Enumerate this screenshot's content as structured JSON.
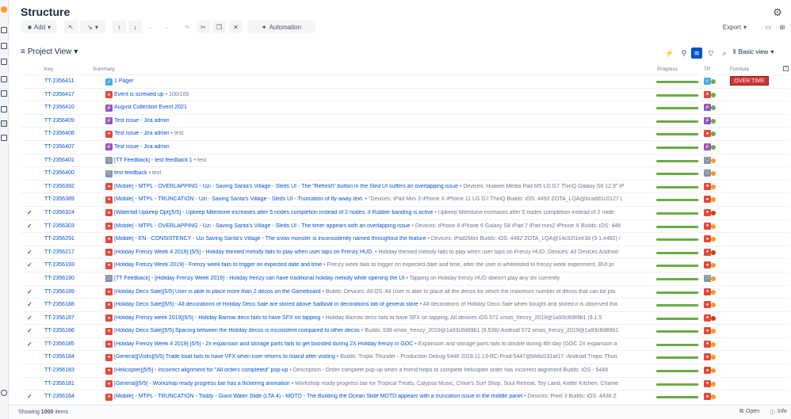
{
  "header": {
    "title": "Structure"
  },
  "toolbar": {
    "add": "Add",
    "automation": "Automation",
    "export": "Export"
  },
  "view": {
    "name": "Project View",
    "basic": "Basic view"
  },
  "columns": {
    "key": "Key",
    "summary": "Summary",
    "progress": "Progress",
    "tp": "TP",
    "formula": "Formula"
  },
  "footer": {
    "showing_prefix": "Showing ",
    "count": "1000",
    "showing_suffix": " items",
    "open": "Open",
    "info": "Info"
  },
  "colors": {
    "bug": "#e5493a",
    "story": "#4bade8",
    "task_done": "#4bade8",
    "epic": "#904ee2",
    "feedback": "#8993a4",
    "progress": "#6aab45",
    "overtime": "#c9373a"
  },
  "rows": [
    {
      "key": "TT-2356411",
      "type": "task",
      "title": "1 Pager",
      "desc": "",
      "checked": false,
      "progress": 0.98,
      "tp_status": "green",
      "formula": "OVER TIME"
    },
    {
      "key": "TT-2356417",
      "type": "bug",
      "title": "Event is screwed up",
      "desc": " • 100/100",
      "checked": false,
      "progress": 0.98,
      "tp_status": "green",
      "formula": ""
    },
    {
      "key": "TT-2356410",
      "type": "epic",
      "title": "August Collection Event 2021",
      "desc": "",
      "checked": false,
      "progress": 0.98,
      "tp_status": "green",
      "formula": ""
    },
    {
      "key": "TT-2356409",
      "type": "epic",
      "title": "Test issue - Jira admin",
      "desc": "",
      "checked": false,
      "progress": 0.98,
      "tp_status": "green",
      "formula": ""
    },
    {
      "key": "TT-2356408",
      "type": "bug",
      "title": "Test issue - Jira admin",
      "desc": " • test",
      "checked": false,
      "progress": 0.98,
      "tp_status": "green",
      "formula": ""
    },
    {
      "key": "TT-2356407",
      "type": "epic",
      "title": "Test issue - Jira admin",
      "desc": "",
      "checked": false,
      "progress": 0.98,
      "tp_status": "green",
      "formula": ""
    },
    {
      "key": "TT-2356401",
      "type": "feedback",
      "title": "[TT Feedback] - test feedback 1",
      "desc": " • test",
      "checked": false,
      "progress": 0.98,
      "tp_status": "orange",
      "formula": ""
    },
    {
      "key": "TT-2356400",
      "type": "feedback",
      "title": "test feedback",
      "desc": " • test",
      "checked": false,
      "progress": 0.98,
      "tp_status": "orange",
      "formula": ""
    },
    {
      "key": "TT-2356392",
      "type": "bug",
      "title": "[Mobile] - MTPL - OVERLAPPING - Uzi - Saving Santa's Village - Sleds UI - The \"Refresh\" button in the Sled UI suffers an overlapping issue",
      "desc": " • Devices: Huawei Media Pad M5 LG G7 ThinQ Galaxy S8 12.9\" iP",
      "checked": false,
      "progress": 0.98,
      "tp_status": "orange",
      "formula": ""
    },
    {
      "key": "TT-2356389",
      "type": "bug",
      "title": "[Mobile] - MTPL - TRUNCATION - Uzi - Saving Santa's Village - Sleds UI - Truncation of fly-away text.",
      "desc": " • \"Devices: iPad Mini 3 iPhone X iPhone 11 LG G7 ThinQ Builds: iOS: 4492 ZOTA_LQA@bcadd1c0127 (",
      "checked": false,
      "progress": 0.98,
      "tp_status": "orange",
      "formula": ""
    },
    {
      "key": "TT-2356324",
      "type": "bug",
      "title": "[Waterfall Upkeep Opt][5/5] - Upkeep Milestone increases after 5 nodes completion instead of 2 nodes, if Rubber banding is active",
      "desc": " • Upkeep Milestone increases after 5 nodes completion instead of 2 node",
      "checked": true,
      "progress": 0.98,
      "tp_status": "red",
      "formula": ""
    },
    {
      "key": "TT-2356303",
      "type": "bug",
      "title": "[Mobile] - MTPL - OVERLAPPING - Uzi - Saving Santa's Village - Sleds UI - The timer appears with an overlapping issue",
      "desc": " • Devices: iPhone 8 iPhone 6 Galaxy S8 iPad 7 iPad mini2 iPhone X Builds: iOS: 448",
      "checked": true,
      "progress": 0.98,
      "tp_status": "orange",
      "formula": ""
    },
    {
      "key": "TT-2356291",
      "type": "bug",
      "title": "[Mobile] - EN - CONSISTENCY - Uzi Saving Santa's Village - The snow monster is inconsistently named throughout the feature",
      "desc": " • Devices: iPad2Mini Builds: iOS: 4482 ZOTA_LQA@14c92f1ee3d (9.1.4482) /",
      "checked": false,
      "progress": 0.98,
      "tp_status": "orange",
      "formula": ""
    },
    {
      "key": "TT-2356217",
      "type": "bug",
      "title": "[Holiday Frenzy Week 4 2019] [5/5] - Holiday themed melody fails to play when user taps on Frenzy HUD.",
      "desc": " • Holiday themed melody fails to play when user taps on Frenzy HUD. Devices: All Devices Android",
      "checked": true,
      "progress": 0.98,
      "tp_status": "red",
      "formula": ""
    },
    {
      "key": "TT-2356193",
      "type": "bug",
      "title": "[Holiday Frenzy Week 2019] - Frenzy week fails to trigger on expected date and time",
      "desc": " • Frenzy week fails to trigger on expected date and time, after the user is whitelisted to frenzy week experiment, BUt pr",
      "checked": true,
      "progress": 0.98,
      "tp_status": "orange",
      "formula": ""
    },
    {
      "key": "TT-2356190",
      "type": "feedback",
      "title": "[TT Feedback] - [Holiday Frenzy Week 2019] - Holiday frenzy can have traditional holiday melody while opening the UI",
      "desc": " • Tapping on Holiday frenzy HUD doesn't play any sfx currently",
      "checked": false,
      "progress": 0.98,
      "tp_status": "orange",
      "formula": ""
    },
    {
      "key": "TT-2356189",
      "type": "bug",
      "title": "[Holiday Deco Sale][5/5] User is able to place more than 2 decos on the Gameboard",
      "desc": " • Builds: Devices: All OS: All User is able to place all the decos for which the maximum number of decos that can be pla",
      "checked": true,
      "progress": 0.98,
      "tp_status": "orange",
      "formula": ""
    },
    {
      "key": "TT-2356188",
      "type": "bug",
      "title": "[Holiday Deco Sale][5/5] - All decorations of Holiday Deco Sale are stored above Sailboat in decorations tab of general store",
      "desc": " • All decorations of Holiday Deco Sale when bought and stored it is observed tha",
      "checked": true,
      "progress": 0.98,
      "tp_status": "orange",
      "formula": ""
    },
    {
      "key": "TT-2356187",
      "type": "bug",
      "title": "[Holiday Frenzy week 2019][5/5] - Holiday Barrow deco fails to have SFX on tapping",
      "desc": " • Holiday Barrow deco fails to have SFX on tapping: All devices iOS 572 xmas_frenzy_2019@1a93c8d89b1 (9.1.5",
      "checked": true,
      "progress": 0.98,
      "tp_status": "red",
      "formula": ""
    },
    {
      "key": "TT-2356186",
      "type": "bug",
      "title": "[Holiday Deco Sale][5/5] Spacing between the Holiday decos is incosistent compared to other decos",
      "desc": " • Builds: 538 xmas_frenzy_2019@1a93c8d89b1 (9.538)-Android 572 xmas_frenzy_2019@1a93c8d89b1",
      "checked": true,
      "progress": 0.98,
      "tp_status": "orange",
      "formula": ""
    },
    {
      "key": "TT-2356185",
      "type": "bug",
      "title": "[Holiday Frenzy Week 4 2019] [5/5] - 2x expansion and storage parts fails to get boosted during 2X Holiday frenzy in GOC",
      "desc": " • Expansion and storage parts fails to double during 4th day (GOC 2X expansion a",
      "checked": true,
      "progress": 0.98,
      "tp_status": "orange",
      "formula": ""
    },
    {
      "key": "TT-2356184",
      "type": "bug",
      "title": "[General][Visits][5/5] Trade boat fails to have VFX when user returns to Island after visiting",
      "desc": " • Builds: Tropic Thunder - Production Debug-5448 2019.11.13-RC-Prod-5447@bb6d191af17 -Android Tropic Thun",
      "checked": false,
      "progress": 0.98,
      "tp_status": "orange",
      "formula": ""
    },
    {
      "key": "TT-2356183",
      "type": "bug",
      "title": "[Helicopter][5/5] - Incorrect alignment for \"All orders completed\" pop-up",
      "desc": " • Description - Order complete pop-up when a friend helps to complete helicopter order has incorrect alignment Builds: iOS - 5448",
      "checked": false,
      "progress": 0.98,
      "tp_status": "orange",
      "formula": ""
    },
    {
      "key": "TT-2356181",
      "type": "bug",
      "title": "[General][5/5] - Workshop ready progress bar has a flickering animation",
      "desc": " • Workshop ready progress bar for Tropical Treats, Calypso Music, Chloe's Surf Shop, Soul Retreat, Toy Land, Kettle Kitchen, Chame",
      "checked": false,
      "progress": 0.98,
      "tp_status": "orange",
      "formula": ""
    },
    {
      "key": "TT-2356164",
      "type": "bug",
      "title": "[Mobile] - MTPL - TRUNCATION - Toddy - Giant Water Slide (LTA 4) - MOTD - The Building the Ocean Slide MOTD appears with a truncation issue in the middle panel",
      "desc": " • Devices: Pixel 3 Builds: iOS: 4436 Z",
      "checked": true,
      "progress": 0.98,
      "tp_status": "orange",
      "formula": ""
    }
  ]
}
